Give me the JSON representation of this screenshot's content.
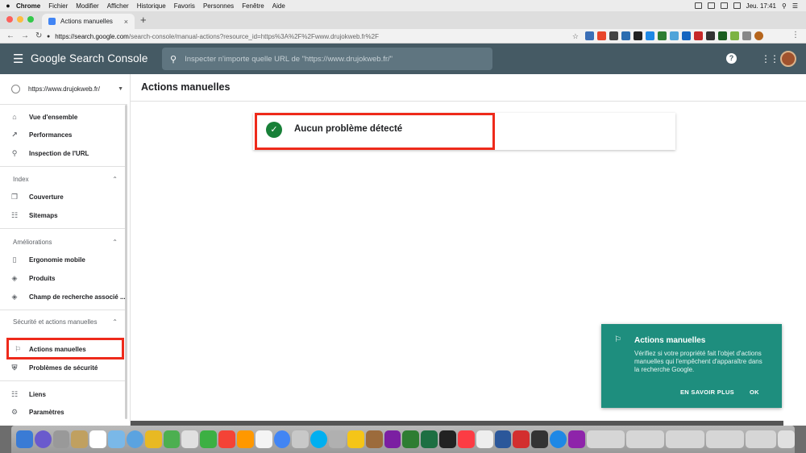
{
  "mac_menu": {
    "apple": "",
    "items": [
      "Chrome",
      "Fichier",
      "Modifier",
      "Afficher",
      "Historique",
      "Favoris",
      "Personnes",
      "Fenêtre",
      "Aide"
    ],
    "clock": "Jeu. 17:41"
  },
  "browser": {
    "tab_title": "Actions manuelles",
    "tab_close": "×",
    "new_tab": "+",
    "url_host": "https://search.google.com",
    "url_path": "/search-console/manual-actions?resource_id=https%3A%2F%2Fwww.drujokweb.fr%2F"
  },
  "header": {
    "brand": "Google Search Console",
    "search_placeholder": "Inspecter n'importe quelle URL de \"https://www.drujokweb.fr/\"",
    "help": "?"
  },
  "sidebar": {
    "property": "https://www.drujokweb.fr/",
    "top_items": [
      {
        "label": "Vue d'ensemble",
        "icon": "home-icon"
      },
      {
        "label": "Performances",
        "icon": "trending-up-icon"
      },
      {
        "label": "Inspection de l'URL",
        "icon": "search-icon"
      }
    ],
    "section_index": "Index",
    "index_items": [
      {
        "label": "Couverture",
        "icon": "copy-icon"
      },
      {
        "label": "Sitemaps",
        "icon": "sitemap-icon"
      }
    ],
    "section_ameliorations": "Améliorations",
    "amelioration_items": [
      {
        "label": "Ergonomie mobile",
        "icon": "phone-icon"
      },
      {
        "label": "Produits",
        "icon": "layers-icon"
      },
      {
        "label": "Champ de recherche associé ...",
        "icon": "layers-icon"
      }
    ],
    "section_securite": "Sécurité et actions manuelles",
    "securite_items": [
      {
        "label": "Actions manuelles",
        "icon": "flag-icon"
      },
      {
        "label": "Problèmes de sécurité",
        "icon": "shield-icon"
      }
    ],
    "bottom_items": [
      {
        "label": "Liens",
        "icon": "links-icon"
      },
      {
        "label": "Paramètres",
        "icon": "gear-icon"
      }
    ]
  },
  "main": {
    "page_title": "Actions manuelles",
    "status_text": "Aucun problème détecté"
  },
  "toast": {
    "title": "Actions manuelles",
    "body": "Vérifiez si votre propriété fait l'objet d'actions manuelles qui l'empêchent d'apparaître dans la recherche Google.",
    "learn_more": "EN SAVOIR PLUS",
    "ok": "OK"
  },
  "colors": {
    "header_bg": "#455a64",
    "toast_bg": "#1e8e7e",
    "success_green": "#188038",
    "highlight_red": "#ee2a1b"
  }
}
